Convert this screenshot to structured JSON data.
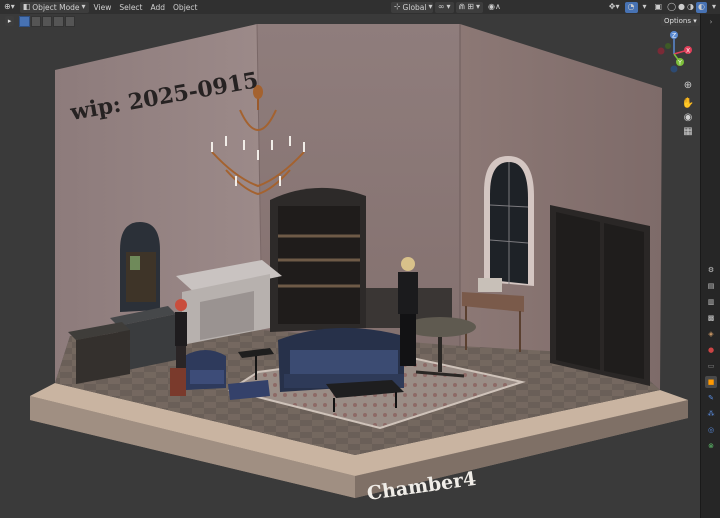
{
  "topbar": {
    "mode_label": "Object Mode",
    "menus": [
      "View",
      "Select",
      "Add",
      "Object"
    ],
    "transform_orientation": "Global",
    "options_label": "Options"
  },
  "scene": {
    "wall_text": "wip: 2025-0915",
    "floor_label": "Chamber4"
  },
  "gizmo": {
    "axis_z": "Z",
    "axis_y": "Y",
    "axis_x": "X"
  },
  "icons": {
    "select": "cursor-icon",
    "hand": "hand-icon",
    "camera": "camera-icon",
    "grid": "grid-icon"
  }
}
